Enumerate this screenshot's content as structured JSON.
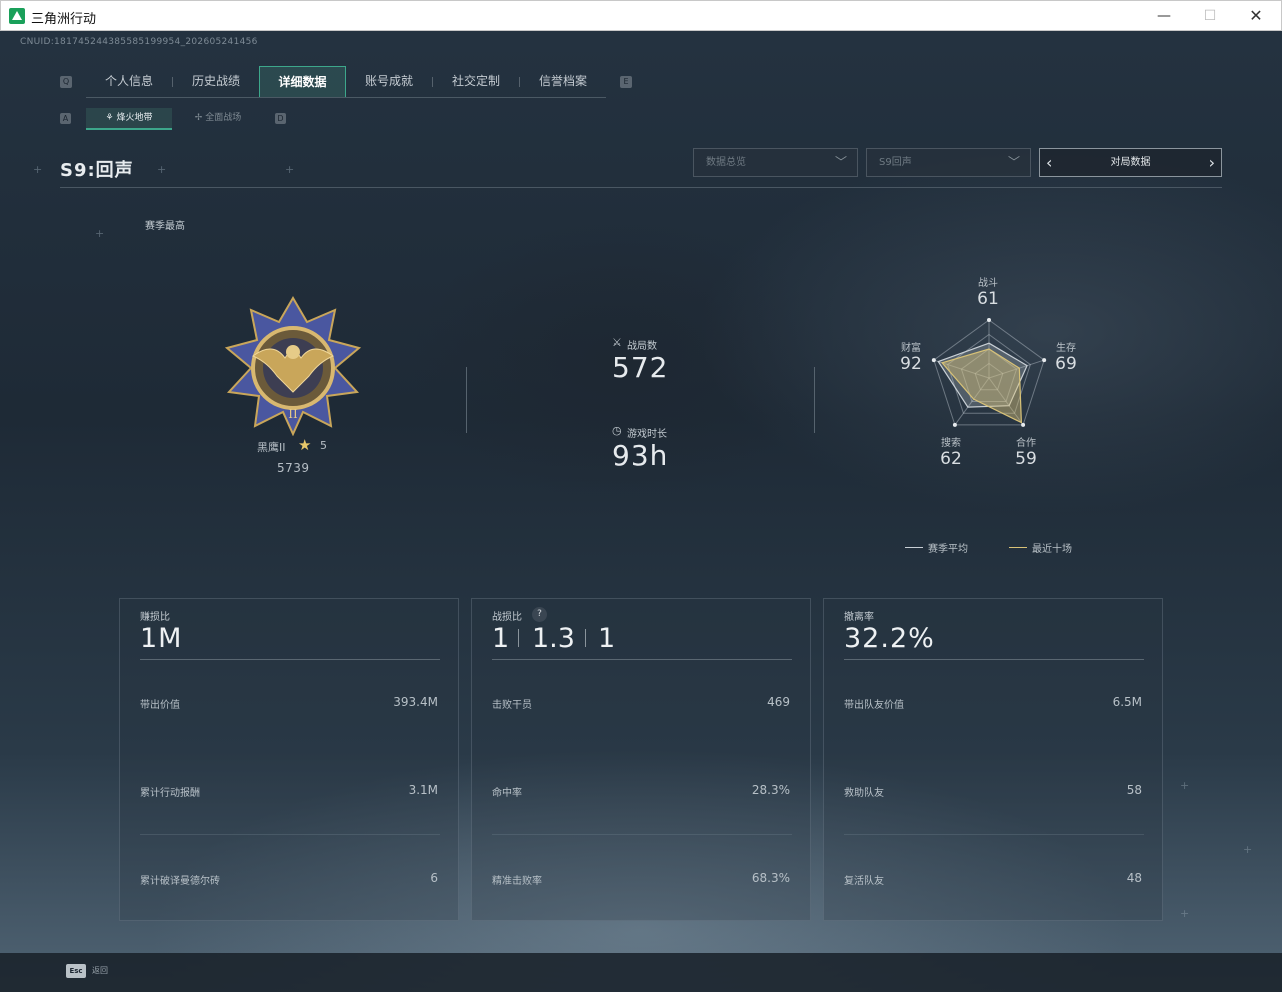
{
  "window": {
    "title": "三角洲行动",
    "minimize": "—",
    "maximize": "☐",
    "close": "✕"
  },
  "cnuid": "CNUID:181745244385585199954_202605241456",
  "nav": {
    "key_left": "Q",
    "key_right": "E",
    "tabs": [
      {
        "label": "个人信息"
      },
      {
        "label": "历史战绩"
      },
      {
        "label": "详细数据",
        "active": true
      },
      {
        "label": "账号成就"
      },
      {
        "label": "社交定制"
      },
      {
        "label": "信誉档案"
      }
    ]
  },
  "subnav": {
    "key_left": "A",
    "key_right": "D",
    "tabs": [
      {
        "label": "烽火地带",
        "active": true,
        "icon": "flame-icon"
      },
      {
        "label": "全面战场",
        "icon": "crosshair-icon"
      }
    ]
  },
  "season_title": "S9:回声",
  "filters": {
    "data_type": "数据总览",
    "season": "S9回声",
    "match_nav_label": "对局数据"
  },
  "season_best_label": "赛季最高",
  "rank": {
    "name": "黑鹰II",
    "stars": "5",
    "score": "5739"
  },
  "stats": {
    "matches_label": "战局数",
    "matches_value": "572",
    "playtime_label": "游戏时长",
    "playtime_value": "93h"
  },
  "radar": {
    "axes": [
      {
        "label": "战斗",
        "value": "61"
      },
      {
        "label": "生存",
        "value": "69"
      },
      {
        "label": "合作",
        "value": "59"
      },
      {
        "label": "搜索",
        "value": "62"
      },
      {
        "label": "财富",
        "value": "92"
      }
    ],
    "recent_values": [
      0.5,
      0.55,
      0.95,
      0.45,
      0.85
    ],
    "season_values": [
      0.6,
      0.69,
      0.59,
      0.62,
      0.92
    ],
    "legend": {
      "season_avg": "赛季平均",
      "recent_ten": "最近十场"
    },
    "colors": {
      "season_avg": "#c8cfd5",
      "recent_ten": "#d8c277"
    }
  },
  "cards": {
    "profit": {
      "label": "赚损比",
      "value": "1M",
      "rows": [
        {
          "label": "带出价值",
          "value": "393.4M"
        },
        {
          "label": "累计行动报酬",
          "value": "3.1M"
        },
        {
          "label": "累计破译曼德尔砖",
          "value": "6"
        }
      ]
    },
    "kd": {
      "label": "战损比",
      "help": "?",
      "parts": [
        "1",
        "1.3",
        "1"
      ],
      "rows": [
        {
          "label": "击败干员",
          "value": "469"
        },
        {
          "label": "命中率",
          "value": "28.3%"
        },
        {
          "label": "精准击败率",
          "value": "68.3%"
        }
      ]
    },
    "extract": {
      "label": "撤离率",
      "value": "32.2%",
      "rows": [
        {
          "label": "带出队友价值",
          "value": "6.5M"
        },
        {
          "label": "救助队友",
          "value": "58"
        },
        {
          "label": "复活队友",
          "value": "48"
        }
      ]
    }
  },
  "bottom": {
    "esc_key": "Esc",
    "esc_label": "返回"
  },
  "colors": {
    "accent": "#3da78b",
    "gold": "#d8c277"
  }
}
